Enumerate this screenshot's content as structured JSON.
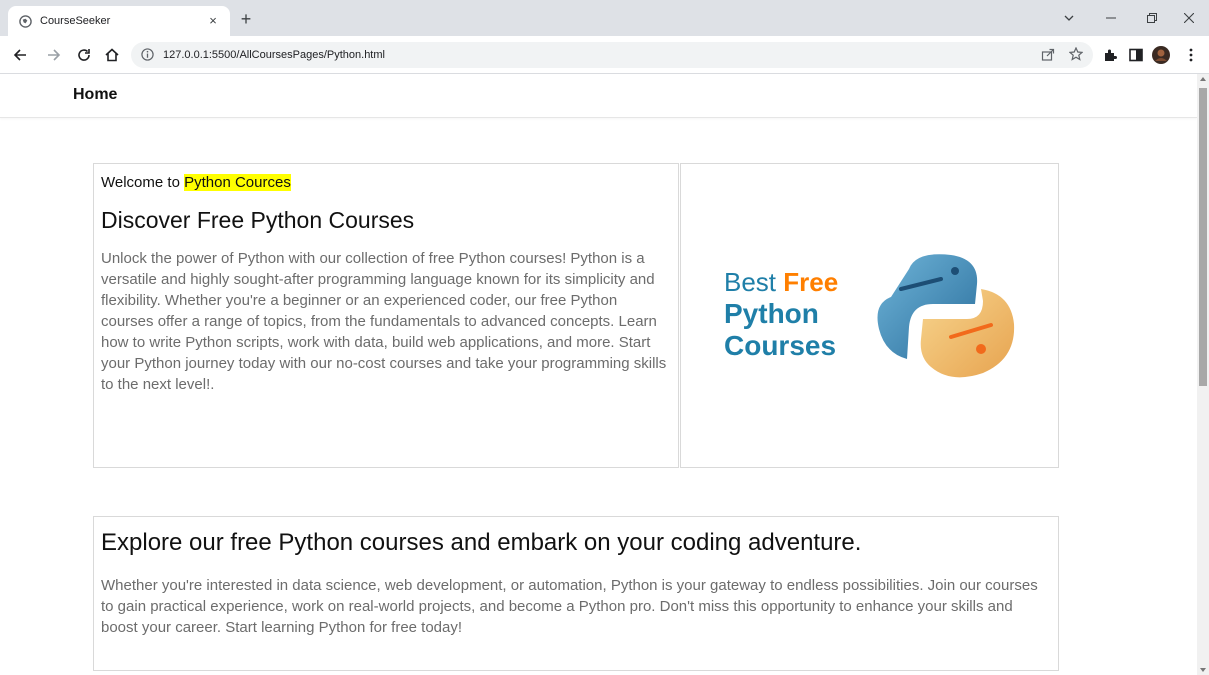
{
  "browser": {
    "tab_title": "CourseSeeker",
    "tab_close": "×",
    "new_tab": "+",
    "url": "127.0.0.1:5500/AllCoursesPages/Python.html"
  },
  "navbar": {
    "home_label": "Home"
  },
  "intro": {
    "welcome_prefix": "Welcome to ",
    "welcome_highlight": "Python Cources",
    "heading": "Discover Free Python Courses",
    "paragraph": "Unlock the power of Python with our collection of free Python courses! Python is a versatile and highly sought-after programming language known for its simplicity and flexibility. Whether you're a beginner or an experienced coder, our free Python courses offer a range of topics, from the fundamentals to advanced concepts. Learn how to write Python scripts, work with data, build web applications, and more. Start your Python journey today with our no-cost courses and take your programming skills to the next level!."
  },
  "banner": {
    "line1_a": "Best ",
    "line1_b": "Free",
    "line2": "Python",
    "line3": "Courses"
  },
  "explore": {
    "heading": "Explore our free Python courses and embark on your coding adventure.",
    "paragraph": "Whether you're interested in data science, web development, or automation, Python is your gateway to endless possibilities. Join our courses to gain practical experience, work on real-world projects, and become a Python pro. Don't miss this opportunity to enhance your skills and boost your career. Start learning Python for free today!"
  },
  "colors": {
    "highlight": "#ffff00",
    "brand_blue": "#1f7fa8",
    "brand_orange": "#ff7f00"
  }
}
